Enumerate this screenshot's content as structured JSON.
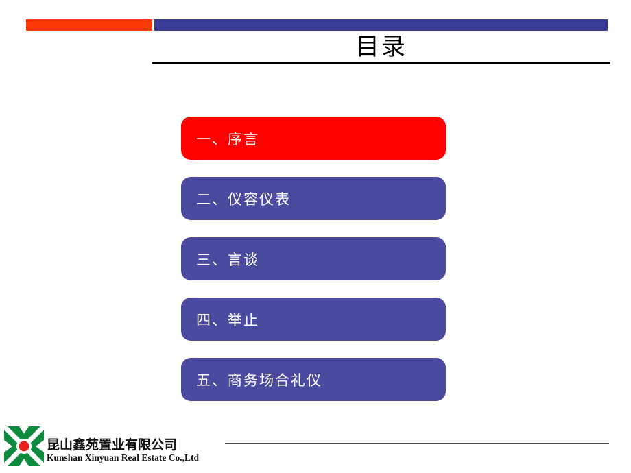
{
  "slide": {
    "title": "目录",
    "background_color": "#FFFFFF"
  },
  "header": {
    "accent_bar_left_color": "#F93A06",
    "accent_bar_right_color": "#3B3B98"
  },
  "contents": {
    "items": [
      {
        "label": "一、序言",
        "color": "#FF0000",
        "state": "highlighted"
      },
      {
        "label": "二、仪容仪表",
        "color": "#4A4A9E",
        "state": "normal"
      },
      {
        "label": "三、言谈",
        "color": "#4A4A9E",
        "state": "normal"
      },
      {
        "label": "四、举止",
        "color": "#4A4A9E",
        "state": "normal"
      },
      {
        "label": "五、商务场合礼仪",
        "color": "#4A4A9E",
        "state": "normal"
      }
    ]
  },
  "footer": {
    "logo_icon": "x-mark-logo-icon",
    "logo_green": "#0E8A3E",
    "logo_dot_red": "#E8201B",
    "company_name_cn": "昆山鑫苑置业有限公司",
    "company_name_en": "Kunshan Xinyuan Real Estate Co.,Ltd"
  }
}
